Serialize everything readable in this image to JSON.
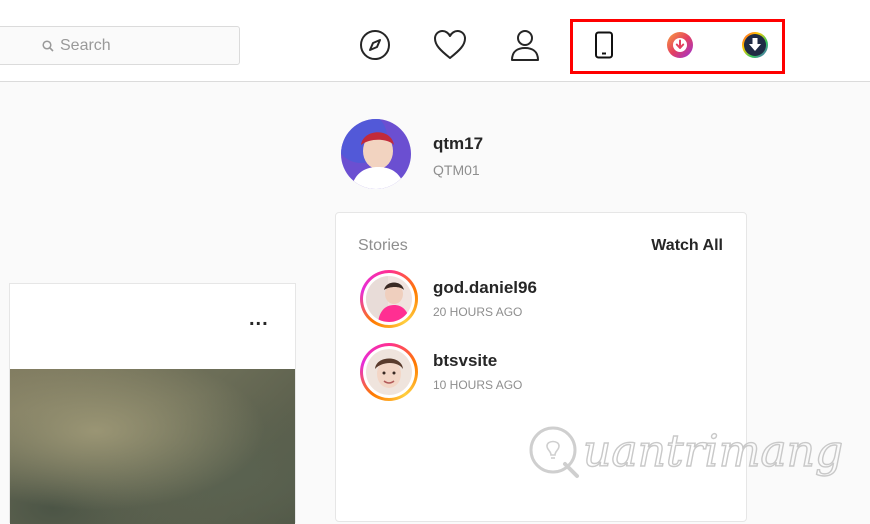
{
  "header": {
    "search": {
      "placeholder": "Search",
      "icon": "search-icon"
    },
    "nav_icons": [
      "compass-icon",
      "heart-icon",
      "person-icon"
    ],
    "extension_icons": [
      "mobile-phone-icon",
      "download-pink-circle-icon",
      "download-dark-circle-icon"
    ],
    "highlight_color": "#ff0000"
  },
  "profile": {
    "username": "qtm17",
    "full_name": "QTM01"
  },
  "stories": {
    "title": "Stories",
    "watch_all": "Watch All",
    "items": [
      {
        "username": "god.daniel96",
        "time": "20 HOURS AGO"
      },
      {
        "username": "btsvsite",
        "time": "10 HOURS AGO"
      }
    ]
  },
  "post": {
    "more_label": "..."
  },
  "watermark": {
    "text": "uantrimang",
    "logo": "quantrimang-logo"
  }
}
